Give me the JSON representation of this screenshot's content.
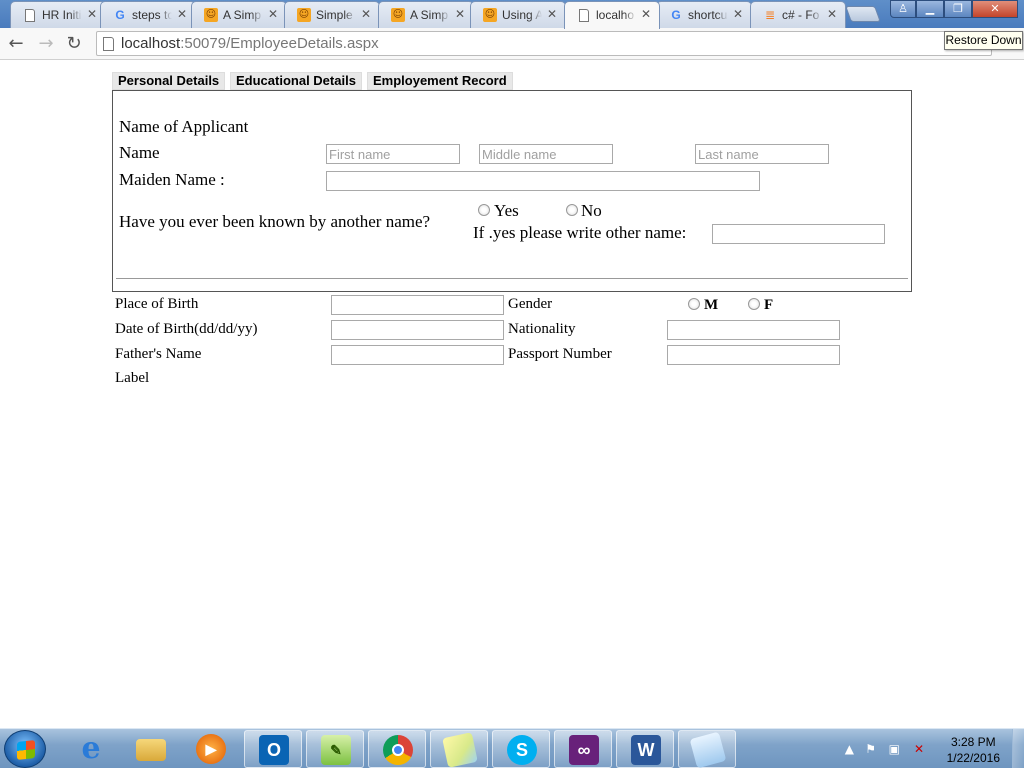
{
  "browser": {
    "tabs": [
      {
        "title": "HR Initi",
        "icon": "page-icon"
      },
      {
        "title": "steps to",
        "icon": "google-icon"
      },
      {
        "title": "A Simp",
        "icon": "codeproject-icon"
      },
      {
        "title": "Simple",
        "icon": "codeproject-icon"
      },
      {
        "title": "A Simp",
        "icon": "codeproject-icon"
      },
      {
        "title": "Using A",
        "icon": "codeproject-icon"
      },
      {
        "title": "localho",
        "icon": "page-icon",
        "active": true
      },
      {
        "title": "shortcu",
        "icon": "google-icon"
      },
      {
        "title": "c# - Fo",
        "icon": "stackoverflow-icon"
      }
    ],
    "close_glyph": "✕",
    "url_host": "localhost",
    "url_rest": ":50079/EmployeeDetails.aspx",
    "tooltip": "Restore Down"
  },
  "page": {
    "tabs": [
      "Personal Details",
      "Educational Details",
      "Employement Record"
    ],
    "name_of_applicant": "Name of Applicant",
    "name_label": "Name",
    "first_name_placeholder": "First name",
    "middle_name_placeholder": "Middle name",
    "last_name_placeholder": "Last name",
    "maiden_name_label": "Maiden Name :",
    "known_by_question": "Have you ever been known by another name?",
    "yes_label": "Yes",
    "no_label": "No",
    "other_name_label": "If .yes please write other name:",
    "place_of_birth_label": "Place of Birth",
    "gender_label": "Gender",
    "gender_m": "M",
    "gender_f": "F",
    "dob_label": "Date of Birth(dd/dd/yy)",
    "nationality_label": "Nationality",
    "fathers_name_label": "Father's Name",
    "passport_label": "Passport Number",
    "label_text": "Label"
  },
  "taskbar": {
    "time": "3:28 PM",
    "date": "1/22/2016"
  }
}
